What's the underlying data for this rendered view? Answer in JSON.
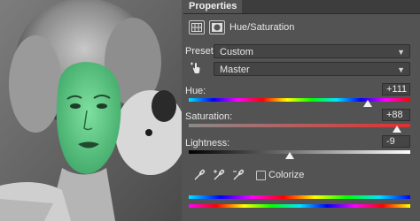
{
  "panel": {
    "tab_label": "Properties",
    "adjustment_title": "Hue/Saturation"
  },
  "preset": {
    "label": "Preset:",
    "value": "Custom"
  },
  "channel": {
    "value": "Master"
  },
  "hue": {
    "label": "Hue:",
    "value": "+111",
    "level": 0.808
  },
  "saturation": {
    "label": "Saturation:",
    "value": "+88",
    "level": 0.94
  },
  "lightness": {
    "label": "Lightness:",
    "value": "-9",
    "level": 0.455
  },
  "colorize": {
    "label": "Colorize",
    "checked": false
  },
  "colors": {
    "panel_bg": "#535353",
    "header_bg": "#3d3d3d",
    "face_tint": "#52c47a"
  },
  "icons": [
    "grid-icon",
    "mask-icon",
    "hand-target-icon",
    "eyedropper-icon",
    "eyedropper-add-icon",
    "eyedropper-subtract-icon",
    "chevron-down-icon"
  ]
}
